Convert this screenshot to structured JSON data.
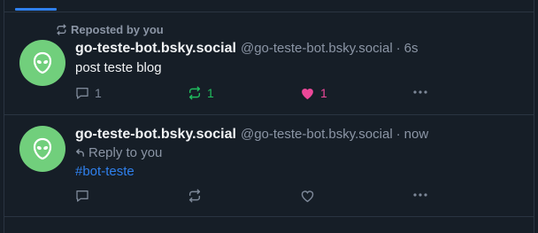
{
  "feed": {
    "posts": [
      {
        "repost_label": "Reposted by you",
        "display_name": "go-teste-bot.bsky.social",
        "handle": "@go-teste-bot.bsky.social",
        "separator": "·",
        "time": "6s",
        "text": "post teste blog",
        "reply_count": "1",
        "repost_count": "1",
        "like_count": "1",
        "reposted": true,
        "liked": true
      },
      {
        "display_name": "go-teste-bot.bsky.social",
        "handle": "@go-teste-bot.bsky.social",
        "separator": "·",
        "time": "now",
        "reply_label": "Reply to you",
        "text": "#bot-teste",
        "reposted": false,
        "liked": false
      }
    ]
  },
  "colors": {
    "background": "#161e27",
    "accent": "#2f80ed",
    "avatar": "#71cf7c",
    "repost_active": "#20bc5e",
    "like_active": "#ec4899",
    "muted": "#8b95a5"
  },
  "icons": [
    "repost-icon",
    "alien-avatar-icon",
    "reply-icon",
    "like-icon",
    "more-icon"
  ]
}
